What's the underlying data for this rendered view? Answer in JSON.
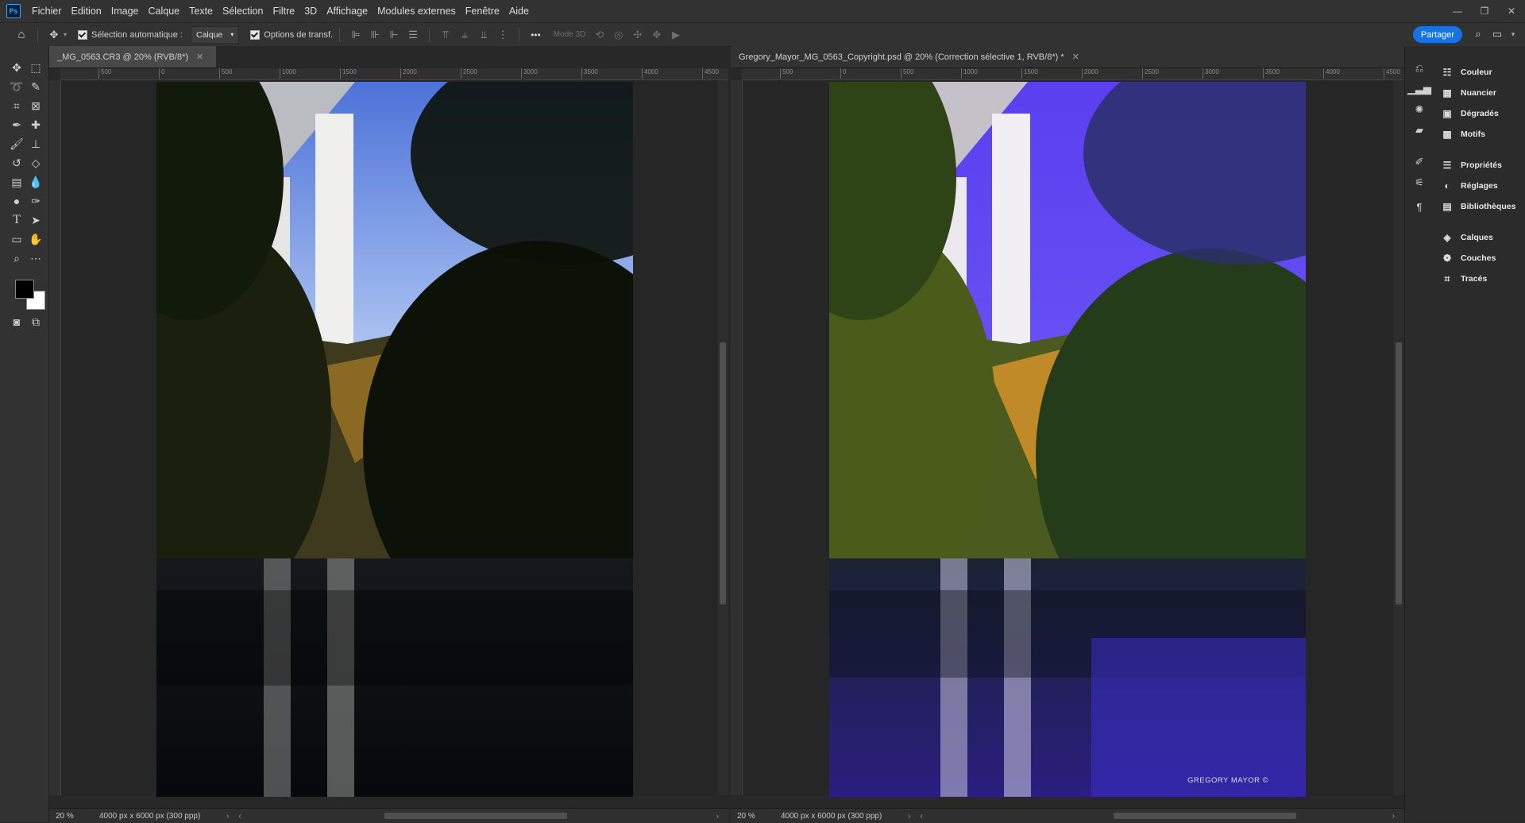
{
  "menu": [
    "Fichier",
    "Edition",
    "Image",
    "Calque",
    "Texte",
    "Sélection",
    "Filtre",
    "3D",
    "Affichage",
    "Modules externes",
    "Fenêtre",
    "Aide"
  ],
  "app_logo": "Ps",
  "window_controls": {
    "minimize": "—",
    "restore": "❐",
    "close": "✕"
  },
  "options": {
    "auto_select_label": "Sélection automatique :",
    "auto_select_value": "Calque",
    "transform_label": "Options de transf.",
    "mode3d_label": "Mode 3D :",
    "more": "•••",
    "share": "Partager"
  },
  "tools": [
    "move-icon",
    "marquee-icon",
    "lasso-icon",
    "quick-select-icon",
    "crop-icon",
    "frame-icon",
    "eyedropper-icon",
    "healing-icon",
    "brush-icon",
    "stamp-icon",
    "history-brush-icon",
    "eraser-icon",
    "gradient-icon",
    "blur-icon",
    "dodge-icon",
    "pen-icon",
    "type-icon",
    "path-select-icon",
    "rectangle-icon",
    "hand-icon",
    "zoom-icon",
    "more-tools-icon",
    "quickmask-icon",
    "screen-mode-icon"
  ],
  "colors": {
    "foreground": "#000000",
    "background": "#ffffff",
    "accent": "#1473e6"
  },
  "doc1": {
    "tab_title": "_MG_0563.CR3 @ 20% (RVB/8*)",
    "ruler_ticks": [
      "500",
      "0",
      "500",
      "1000",
      "1500",
      "2000",
      "2500",
      "3000",
      "3500",
      "4000",
      "4500"
    ],
    "zoom": "20 %",
    "doc_info": "4000 px x 6000 px (300 ppp)"
  },
  "doc2": {
    "tab_title": "Gregory_Mayor_MG_0563_Copyright.psd @ 20% (Correction sélective 1, RVB/8*) *",
    "ruler_ticks": [
      "500",
      "0",
      "500",
      "1000",
      "1500",
      "2000",
      "2500",
      "3000",
      "3500",
      "4000",
      "4500"
    ],
    "zoom": "20 %",
    "doc_info": "4000 px x 6000 px (300 ppp)",
    "watermark": "GREGORY MAYOR ©"
  },
  "panels": {
    "group1": [
      {
        "icon": "color-icon",
        "label": "Couleur"
      },
      {
        "icon": "swatches-icon",
        "label": "Nuancier"
      },
      {
        "icon": "gradients-icon",
        "label": "Dégradés"
      },
      {
        "icon": "patterns-icon",
        "label": "Motifs"
      }
    ],
    "group2": [
      {
        "icon": "properties-icon",
        "label": "Propriétés"
      },
      {
        "icon": "adjustments-icon",
        "label": "Réglages"
      },
      {
        "icon": "libraries-icon",
        "label": "Bibliothèques"
      }
    ],
    "group3": [
      {
        "icon": "layers-icon",
        "label": "Calques"
      },
      {
        "icon": "channels-icon",
        "label": "Couches"
      },
      {
        "icon": "paths-icon",
        "label": "Tracés"
      }
    ]
  }
}
